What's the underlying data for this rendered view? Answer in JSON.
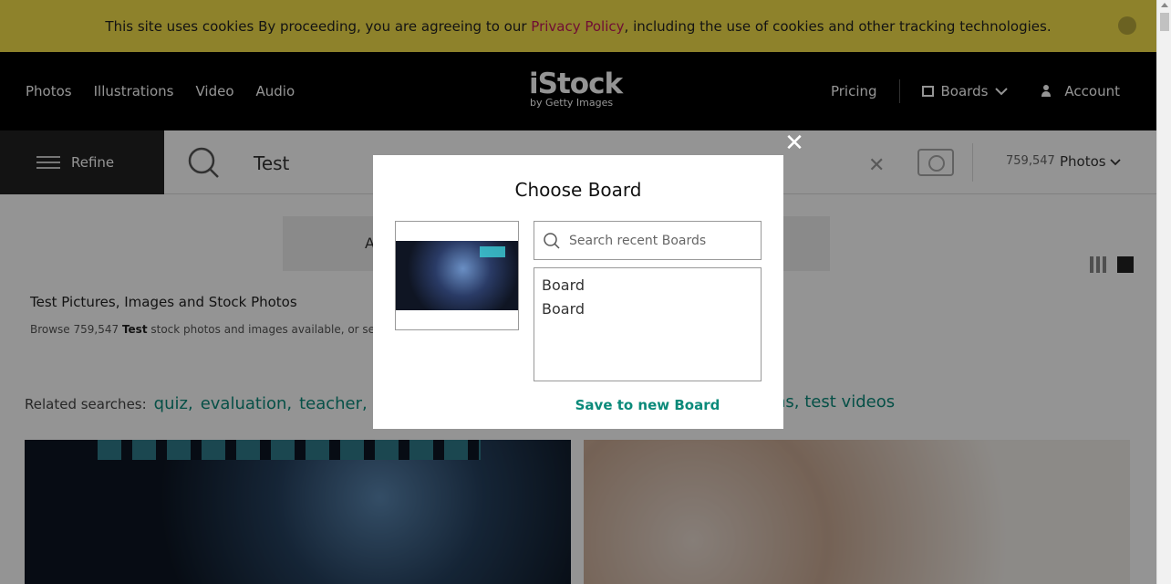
{
  "cookie_banner": {
    "text_before": "This site uses cookies By proceeding, you are agreeing to our ",
    "link": "Privacy Policy",
    "text_after": ", including the use of cookies and other tracking technologies."
  },
  "header": {
    "nav_left": [
      "Photos",
      "Illustrations",
      "Video",
      "Audio"
    ],
    "logo_main": "iStock",
    "logo_sub": "by Getty Images",
    "pricing": "Pricing",
    "boards": "Boards",
    "account": "Account"
  },
  "search": {
    "refine_label": "Refine",
    "query": "Test",
    "result_count": "759,547",
    "result_type": "Photos"
  },
  "content": {
    "tab_letter": "A",
    "heading": "Test Pictures, Images and Stock Photos",
    "browse_prefix": "Browse 759,547 ",
    "browse_bold": "Test",
    "browse_suffix": " stock photos and images available, or search",
    "related_label": "Related searches:",
    "related": [
      "quiz,",
      "evaluation,",
      "teacher,"
    ],
    "related_right": [
      "ns,",
      "test videos"
    ]
  },
  "modal": {
    "title": "Choose Board",
    "search_placeholder": "Search recent Boards",
    "boards": [
      "Board",
      "Board"
    ],
    "save_new": "Save to new Board"
  },
  "colors": {
    "accent": "#0b8a7a",
    "cookie_bg": "#f5e04a",
    "link": "#c2185b"
  }
}
